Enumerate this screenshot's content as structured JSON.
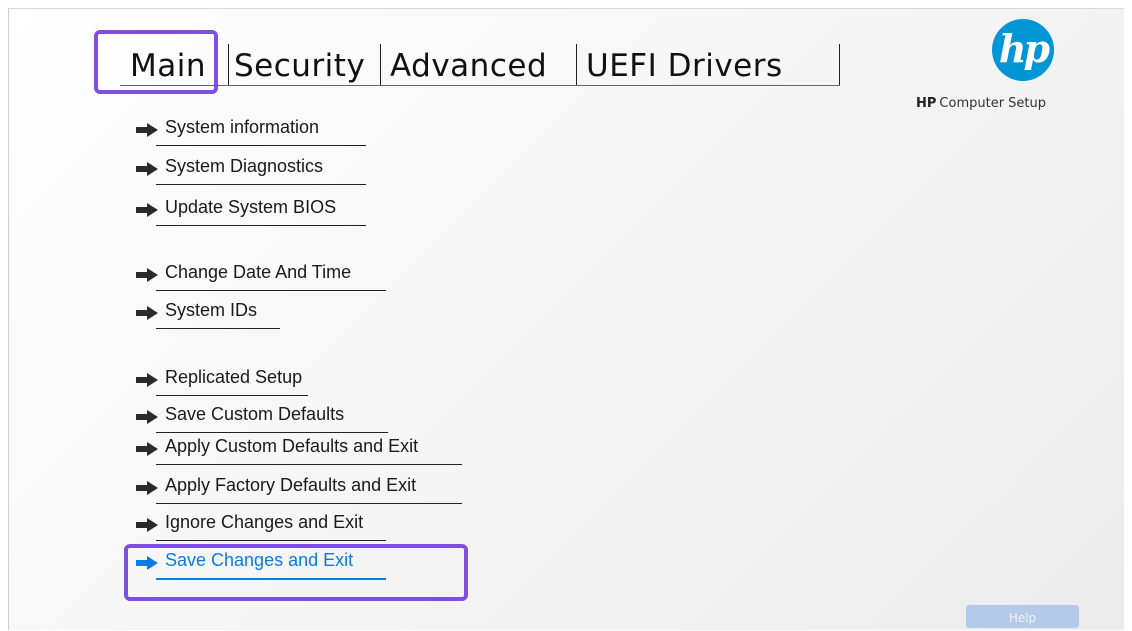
{
  "tabs": [
    {
      "label": "Main"
    },
    {
      "label": "Security"
    },
    {
      "label": "Advanced"
    },
    {
      "label": "UEFI Drivers"
    }
  ],
  "active_tab": "Main",
  "logo_text": "hp",
  "product": {
    "brand": "HP",
    "name": "Computer Setup"
  },
  "menu": [
    {
      "label": "System information"
    },
    {
      "label": "System Diagnostics"
    },
    {
      "label": "Update System BIOS"
    },
    {
      "label": "Change Date And Time"
    },
    {
      "label": "System IDs"
    },
    {
      "label": "Replicated Setup"
    },
    {
      "label": "Save Custom Defaults"
    },
    {
      "label": "Apply Custom Defaults and Exit"
    },
    {
      "label": "Apply Factory Defaults and Exit"
    },
    {
      "label": "Ignore Changes and Exit"
    },
    {
      "label": "Save Changes and Exit"
    }
  ],
  "selected_item": "Save Changes and Exit",
  "help_label": "Help",
  "colors": {
    "accent": "#0a7be0",
    "highlight": "#7f4fe0",
    "brand": "#0096d6"
  }
}
